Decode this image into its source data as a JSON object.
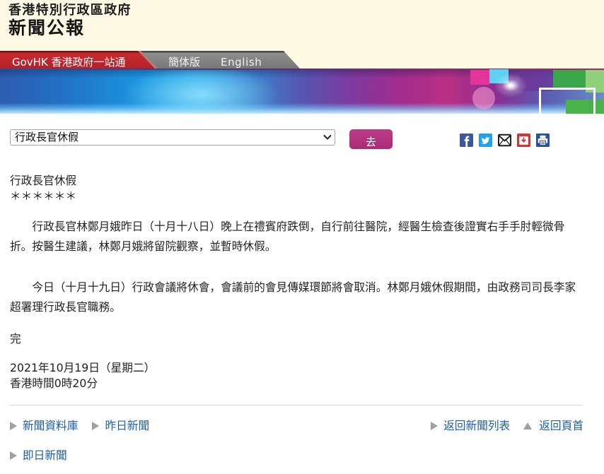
{
  "header": {
    "government_name": "香港特別行政區政府",
    "title": "新聞公報"
  },
  "nav": {
    "govhk": "GovHK 香港政府一站通",
    "simplified_chinese": "簡体版",
    "english": "English"
  },
  "toolbar": {
    "selected_release": "行政長官休假",
    "go_label": "去",
    "select_icon": "chevron-down-icon",
    "share_icons": [
      "facebook-icon",
      "twitter-icon",
      "email-icon",
      "bookmark-icon",
      "print-icon"
    ]
  },
  "article": {
    "title": "行政長官休假",
    "separator": "＊＊＊＊＊＊",
    "paragraphs": [
      "行政長官林鄭月娥昨日（十月十八日）晚上在禮賓府跌倒，自行前往醫院，經醫生檢查後證實右手手肘輕微骨折。按醫生建議，林鄭月娥將留院觀察，並暫時休假。",
      "今日（十月十九日）行政會議將休會，會議前的會見傳媒環節將會取消。林鄭月娥休假期間，由政務司司長李家超署理行政長官職務。"
    ],
    "end_mark": "完",
    "date": "2021年10月19日（星期二）",
    "time": "香港時間0時20分"
  },
  "footer": {
    "left_links": [
      {
        "label": "新聞資料庫",
        "icon": "triangle-right-icon"
      },
      {
        "label": "昨日新聞",
        "icon": "triangle-right-icon"
      }
    ],
    "right_links": [
      {
        "label": "返回新聞列表",
        "icon": "triangle-right-icon"
      },
      {
        "label": "返回頁首",
        "icon": "triangle-up-icon"
      }
    ],
    "bottom_links": [
      {
        "label": "即日新聞",
        "icon": "triangle-right-icon"
      }
    ]
  },
  "colors": {
    "header_background": "#fdf9e4",
    "govhk_tab": "#bd262c",
    "language_tab": "#7c7c7c",
    "go_button": "#b2327e",
    "link": "#1c5eaa",
    "text": "#222222",
    "divider": "#d9d9d9"
  }
}
